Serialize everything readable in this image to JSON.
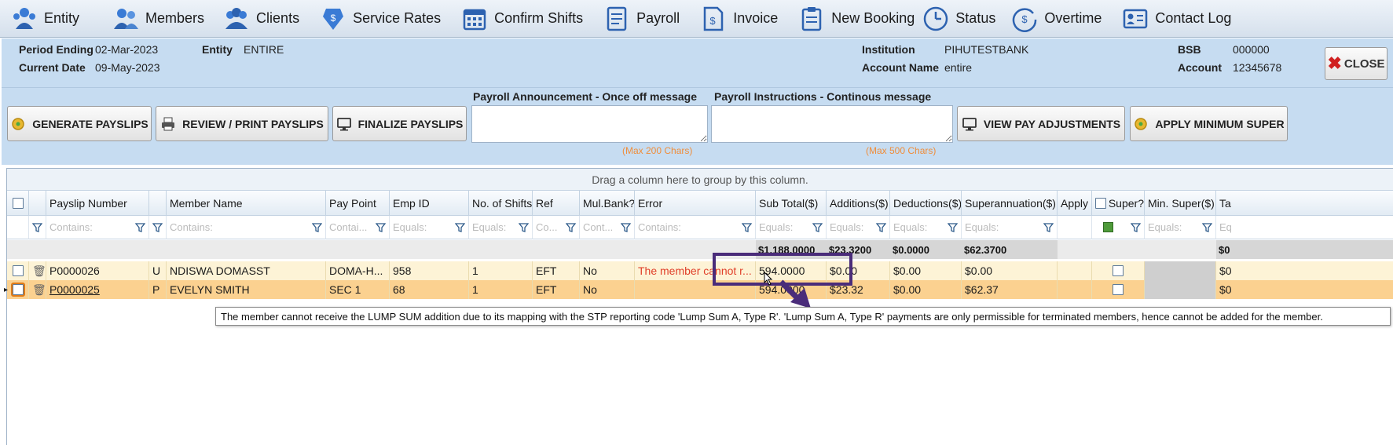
{
  "nav": [
    {
      "label": "Entity",
      "icon": "entity-icon"
    },
    {
      "label": "Members",
      "icon": "members-icon"
    },
    {
      "label": "Clients",
      "icon": "clients-icon"
    },
    {
      "label": "Service Rates",
      "icon": "service-rates-icon"
    },
    {
      "label": "Confirm Shifts",
      "icon": "calendar-icon"
    },
    {
      "label": "Payroll",
      "icon": "payroll-icon"
    },
    {
      "label": "Invoice",
      "icon": "invoice-icon"
    },
    {
      "label": "New Booking",
      "icon": "clipboard-icon"
    },
    {
      "label": "Status",
      "icon": "clock-icon"
    },
    {
      "label": "Overtime",
      "icon": "overtime-clock-icon"
    },
    {
      "label": "Contact Log",
      "icon": "contact-card-icon"
    }
  ],
  "header": {
    "period_ending_label": "Period Ending",
    "period_ending_value": "02-Mar-2023",
    "entity_label": "Entity",
    "entity_value": "ENTIRE",
    "current_date_label": "Current Date",
    "current_date_value": "09-May-2023",
    "institution_label": "Institution",
    "institution_value": "PIHUTESTBANK",
    "account_name_label": "Account Name",
    "account_name_value": "entire",
    "bsb_label": "BSB",
    "bsb_value": "000000",
    "account_label": "Account",
    "account_value": "12345678",
    "close_label": "CLOSE"
  },
  "toolbar": {
    "generate_label": "GENERATE PAYSLIPS",
    "review_label": "REVIEW / PRINT PAYSLIPS",
    "finalize_label": "FINALIZE PAYSLIPS",
    "announcement_label": "Payroll Announcement - Once off message",
    "announcement_value": "",
    "announcement_max": "(Max 200 Chars)",
    "instructions_label": "Payroll Instructions - Continous message",
    "instructions_value": "",
    "instructions_max": "(Max 500 Chars)",
    "view_adjustments_label": "VIEW PAY ADJUSTMENTS",
    "apply_min_super_label": "APPLY MINIMUM SUPER"
  },
  "grid": {
    "group_panel_text": "Drag a column here to group by this column.",
    "columns": [
      "",
      "",
      "Payslip Number",
      "",
      "Member Name",
      "Pay Point",
      "Emp ID",
      "No. of Shifts",
      "Ref",
      "Mul.Bank?",
      "Error",
      "Sub Total($)",
      "Additions($)",
      "Deductions($)",
      "Superannuation($)",
      "Apply",
      "Super?",
      "Min. Super($)",
      "Ta"
    ],
    "filters": [
      "",
      "",
      "Contains:",
      "",
      "Contains:",
      "Contai...",
      "Equals:",
      "Equals:",
      "Co...",
      "Cont...",
      "Contains:",
      "Equals:",
      "Equals:",
      "Equals:",
      "Equals:",
      "",
      "",
      "Equals:",
      "Eq"
    ],
    "totals": {
      "sub_total": "$1,188.0000",
      "additions": "$23.3200",
      "deductions": "$0.0000",
      "superannuation": "$62.3700",
      "ta": "$0"
    },
    "rows": [
      {
        "payslip": "P0000026",
        "type": "U",
        "member": "NDISWA DOMASST",
        "pay_point": "DOMA-H...",
        "emp_id": "958",
        "shifts": "1",
        "ref": "EFT",
        "mul_bank": "No",
        "error": "The member cannot r...",
        "sub_total": "594.0000",
        "additions": "$0.00",
        "deductions": "$0.00",
        "super": "$0.00",
        "ta": "$0"
      },
      {
        "payslip": "P0000025",
        "type": "P",
        "member": "EVELYN SMITH",
        "pay_point": "SEC 1",
        "emp_id": "68",
        "shifts": "1",
        "ref": "EFT",
        "mul_bank": "No",
        "error": "",
        "sub_total": "594.0000",
        "additions": "$23.32",
        "deductions": "$0.00",
        "super": "$62.37",
        "ta": "$0"
      }
    ],
    "row_indicator": "▸"
  },
  "tooltip": "The member cannot receive the LUMP SUM addition due to its mapping with the STP reporting code 'Lump Sum A, Type R'. 'Lump Sum A, Type R' payments are only permissible for terminated members, hence cannot be added for the member.",
  "colors": {
    "accent_purple": "#4a2c7a",
    "error_red": "#e0402a",
    "selected_row": "#fbd190",
    "row_highlight": "#fdf3d6",
    "header_blue": "#c6dcf1"
  }
}
